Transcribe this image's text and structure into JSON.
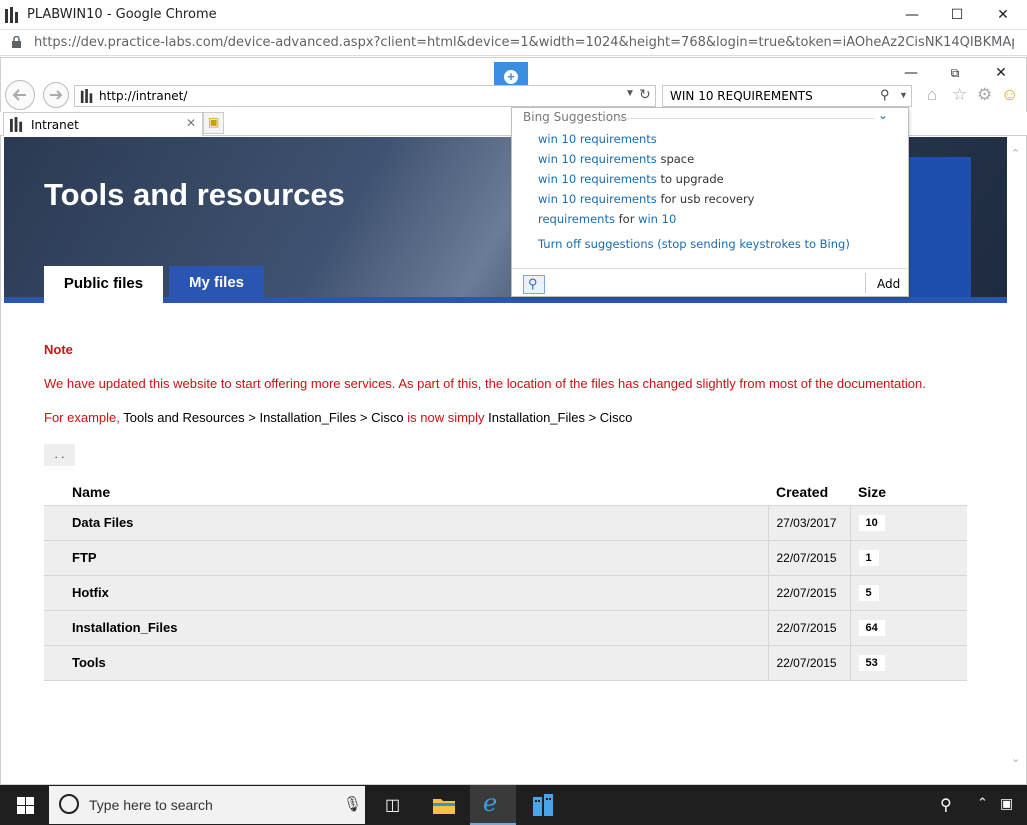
{
  "chrome": {
    "window_title": "PLABWIN10 - Google Chrome",
    "url": "https://dev.practice-labs.com/device-advanced.aspx?client=html&device=1&width=1024&height=768&login=true&token=iAOheAz2CisNK14QIBKMAp74b..."
  },
  "ie": {
    "address": "http://intranet/",
    "search_value": "WIN 10 REQUIREMENTS",
    "tab_title": "Intranet"
  },
  "bing": {
    "header": "Bing Suggestions",
    "suggestions": [
      {
        "match": "win 10 requirements",
        "rest": ""
      },
      {
        "match": "win 10 requirements",
        "rest": " space"
      },
      {
        "match": "win 10 requirements",
        "rest": " to upgrade"
      },
      {
        "match": "win 10 requirements",
        "rest": " for usb recovery"
      },
      {
        "match": "requirements",
        "rest": " for ",
        "match2": "win 10"
      }
    ],
    "turn_off": "Turn off suggestions (stop sending keystrokes to Bing)",
    "add": "Add"
  },
  "page": {
    "title": "Tools and resources",
    "tabs": {
      "public": "Public files",
      "my": "My files"
    },
    "note_label": "Note",
    "message1": "We have updated this website to start offering more services. As part of this, the location of the files has changed slightly from most of the documentation.",
    "message2_prefix": "For example, ",
    "message2_old": "Tools and Resources > Installation_Files > Cisco",
    "message2_mid": " is now simply ",
    "message2_new": "Installation_Files > Cisco",
    "up_dir": ". .",
    "columns": {
      "name": "Name",
      "created": "Created",
      "size": "Size"
    },
    "files": [
      {
        "name": "Data Files",
        "created": "27/03/2017",
        "size": "10"
      },
      {
        "name": "FTP",
        "created": "22/07/2015",
        "size": "1"
      },
      {
        "name": "Hotfix",
        "created": "22/07/2015",
        "size": "5"
      },
      {
        "name": "Installation_Files",
        "created": "22/07/2015",
        "size": "64"
      },
      {
        "name": "Tools",
        "created": "22/07/2015",
        "size": "53"
      }
    ]
  },
  "taskbar": {
    "search_placeholder": "Type here to search"
  },
  "colors": {
    "accent_blue": "#2a56b2",
    "note_red": "#cc1111",
    "link_blue": "#1a6caf"
  }
}
